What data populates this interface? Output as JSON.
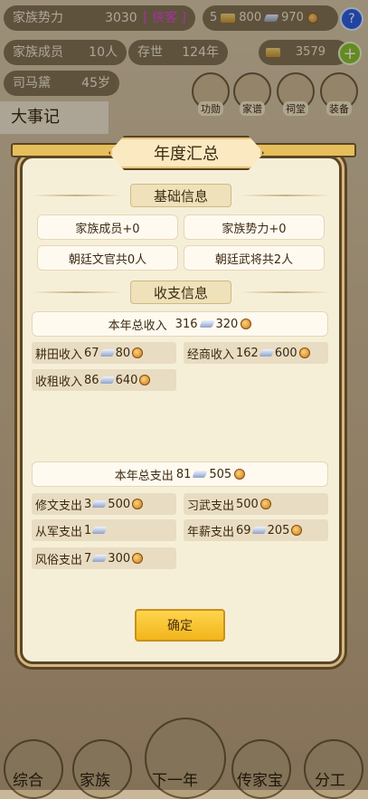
{
  "top": {
    "clan_power_label": "家族势力",
    "clan_power_value": "3030",
    "clan_power_tag": "[ 侠客 ]",
    "clan_members_label": "家族成员",
    "clan_members_value": "10人",
    "exist_label": "存世",
    "exist_value": "124年",
    "leader_name": "司马黛",
    "leader_age": "45岁",
    "res_gold": "5",
    "res_silver": "800",
    "res_coin": "970",
    "res_ingot": "3579"
  },
  "actions": [
    "功勋",
    "家谱",
    "祠堂",
    "装备"
  ],
  "events_title": "大事记",
  "bottom_nav": [
    "综合",
    "家族",
    "下一年",
    "传家宝",
    "分工"
  ],
  "modal": {
    "title": "年度汇总",
    "section_basic": "基础信息",
    "basic": [
      "家族成员+0",
      "家族势力+0",
      "朝廷文官共0人",
      "朝廷武将共2人"
    ],
    "section_finance": "收支信息",
    "total_income_label": "本年总收入",
    "total_income_a": "316",
    "total_income_b": "320",
    "income_items": [
      {
        "label": "耕田收入",
        "a": "67",
        "b": "80"
      },
      {
        "label": "经商收入",
        "a": "162",
        "b": "600"
      },
      {
        "label": "收租收入",
        "a": "86",
        "b": "640"
      }
    ],
    "total_expense_label": "本年总支出",
    "total_expense_a": "81",
    "total_expense_b": "505",
    "expense_items": [
      {
        "label": "修文支出",
        "a": "3",
        "b": "500"
      },
      {
        "label": "习武支出",
        "a": "",
        "b": "500"
      },
      {
        "label": "从军支出",
        "a": "1",
        "b": ""
      },
      {
        "label": "年薪支出",
        "a": "69",
        "b": "205"
      },
      {
        "label": "风俗支出",
        "a": "7",
        "b": "300"
      }
    ],
    "confirm": "确定"
  }
}
